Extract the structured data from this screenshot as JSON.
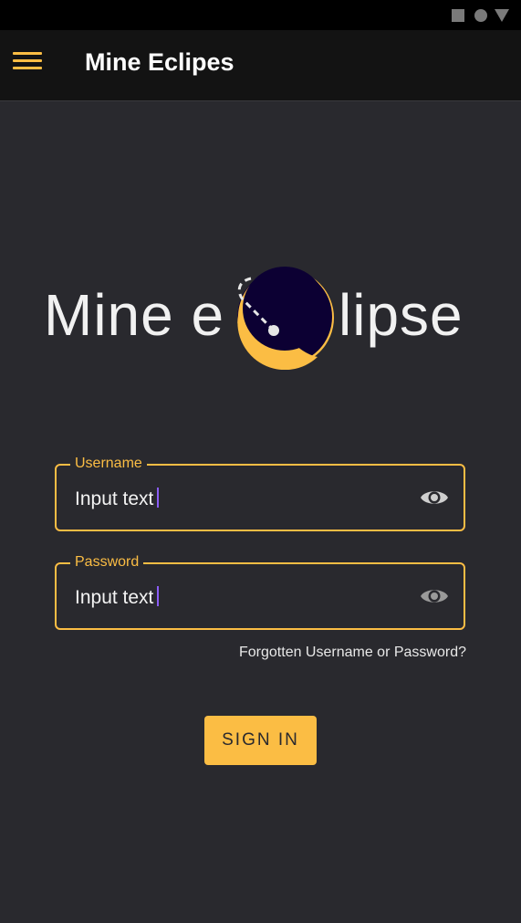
{
  "app_bar": {
    "title": "Mine Eclipes",
    "menu_icon": "hamburger-menu-icon"
  },
  "status_bar": {
    "icons": [
      "square-icon",
      "circle-icon",
      "triangle-icon"
    ]
  },
  "logo": {
    "text_left": "Mine e",
    "text_right": "lipse",
    "icon": "eclipse-moon-icon",
    "colors": {
      "moon": "#fbbd44",
      "shadow": "#0c0033",
      "orbit": "#e6e6e6"
    }
  },
  "login_form": {
    "username": {
      "label": "Username",
      "value": "Input text",
      "icon": "eye-icon"
    },
    "password": {
      "label": "Password",
      "value": "Input text",
      "icon": "eye-icon"
    },
    "forgot_link": "Forgotten Username or Password?",
    "signin_label": "SIGN IN"
  },
  "colors": {
    "accent": "#fbbd44",
    "background": "#29292e",
    "app_bar": "#131313"
  }
}
